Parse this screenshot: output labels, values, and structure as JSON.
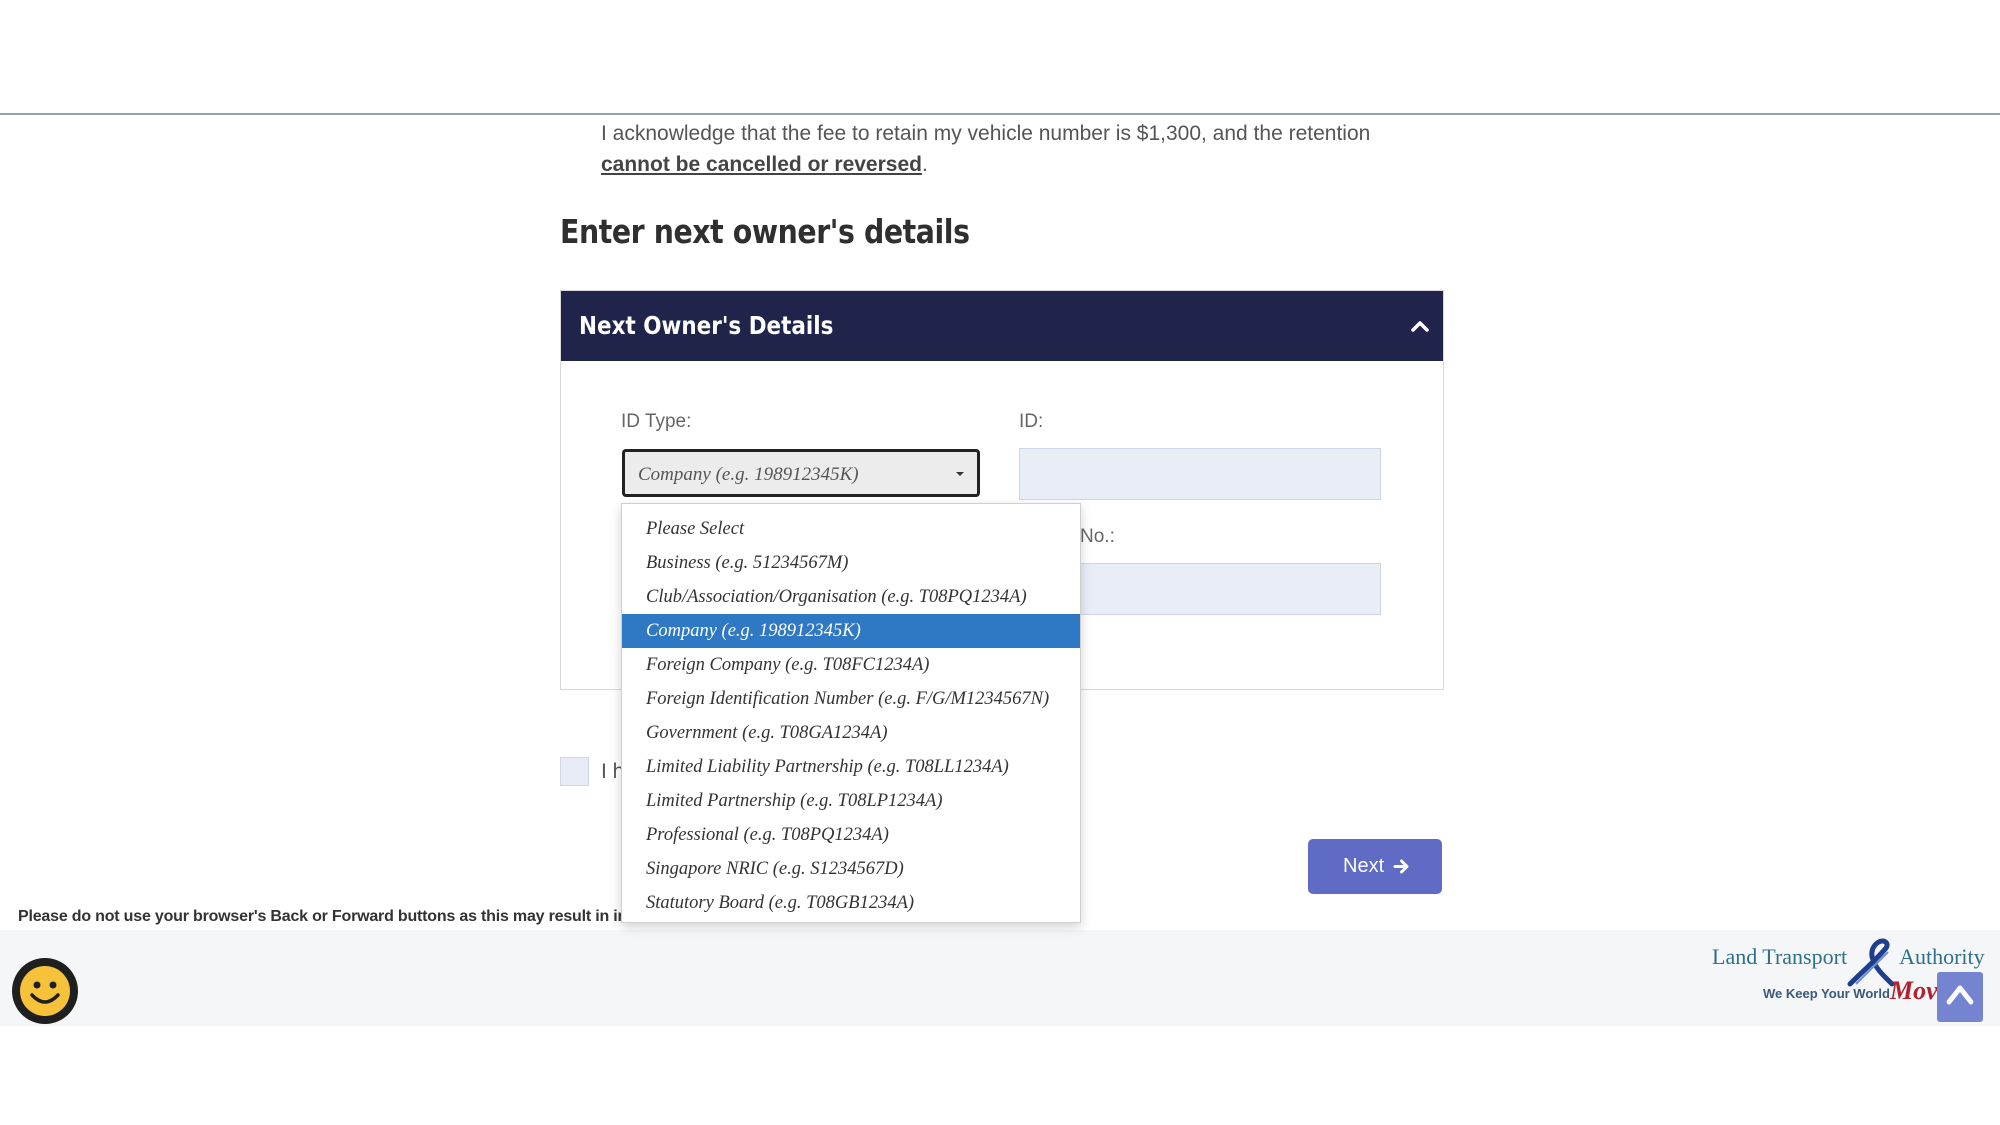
{
  "acknowledgement": {
    "text_before": "I acknowledge that the fee to retain my vehicle number is $1,300, and the retention ",
    "emphasis": "cannot be cancelled or reversed",
    "text_after": "."
  },
  "section": {
    "heading": "Enter next owner's details"
  },
  "panel": {
    "title": "Next Owner's Details",
    "id_type_label": "ID Type:",
    "id_type_selected": "Company (e.g. 198912345K)",
    "id_label": "ID:",
    "hidden_label_fragment": "No.:"
  },
  "dropdown": {
    "options": [
      "Please Select",
      "Business (e.g. 51234567M)",
      "Club/Association/Organisation (e.g. T08PQ1234A)",
      "Company (e.g. 198912345K)",
      "Foreign Company (e.g. T08FC1234A)",
      "Foreign Identification Number (e.g. F/G/M1234567N)",
      "Government (e.g. T08GA1234A)",
      "Limited Liability Partnership (e.g. T08LL1234A)",
      "Limited Partnership (e.g. T08LP1234A)",
      "Professional (e.g. T08PQ1234A)",
      "Singapore NRIC (e.g. S1234567D)",
      "Statutory Board (e.g. T08GB1234A)"
    ],
    "selected_index": 3
  },
  "checkbox": {
    "label_fragment": "I h"
  },
  "buttons": {
    "next_label": "Next"
  },
  "warning": {
    "text": "Please do not use your browser's Back or Forward buttons as this may result in info"
  },
  "footer": {
    "logo": {
      "name_left": "Land Transport",
      "name_right": "Authority",
      "tagline": "We Keep Your World",
      "tagline_script": "Mov"
    }
  },
  "colors": {
    "panel_header": "#21244a",
    "selected_option": "#2f78c4",
    "next_button": "#5f6bc4",
    "input_fill": "#e8edf6"
  },
  "icons": [
    "chevron-up-icon",
    "caret-down-icon",
    "arrow-right-icon",
    "smiley-icon",
    "arrow-up-icon"
  ]
}
